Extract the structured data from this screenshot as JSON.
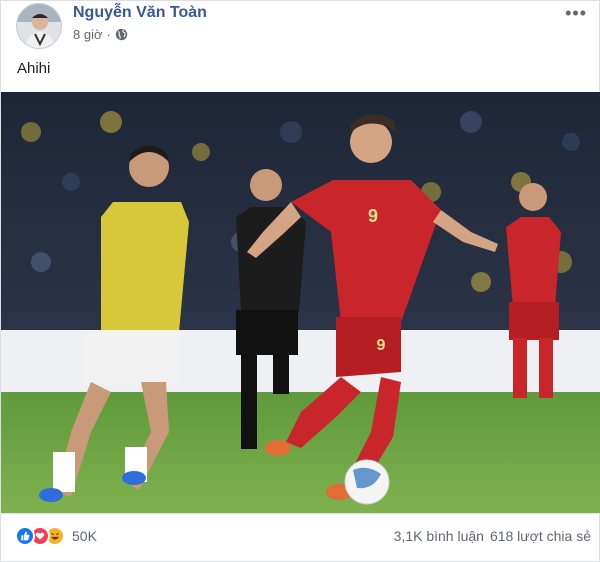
{
  "post": {
    "author": "Nguyễn Văn Toàn",
    "time": "8 giờ",
    "text": "Ahihi",
    "player_number": "9"
  },
  "icons": {
    "privacy": "globe-icon",
    "menu": "more-icon",
    "reactions": [
      "like-icon",
      "love-icon",
      "haha-icon"
    ]
  },
  "footer": {
    "reaction_count": "50K",
    "comments": "3,1K bình luận",
    "shares": "618 lượt chia sẻ"
  },
  "colors": {
    "link": "#385898",
    "like": "#1877f2",
    "love": "#f33e58",
    "haha": "#f7b125"
  }
}
